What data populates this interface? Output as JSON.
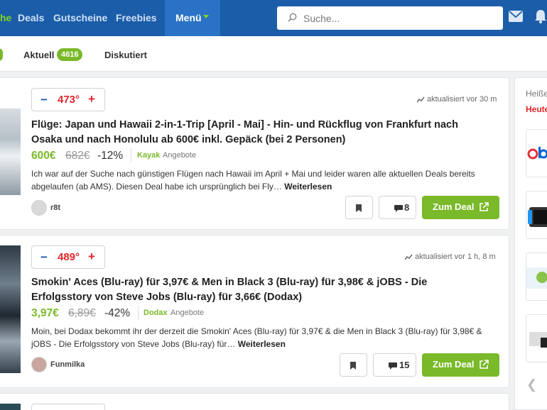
{
  "nav": {
    "partial_item": "he",
    "deals": "Deals",
    "gutscheine": "Gutscheine",
    "freebies": "Freebies",
    "menu": "Menü",
    "search_placeholder": "Suche..."
  },
  "tabs": {
    "aktuell": "Aktuell",
    "aktuell_count": "4616",
    "diskutiert": "Diskutiert"
  },
  "deals": [
    {
      "temperature": "473°",
      "updated": "aktualisiert vor 30 m",
      "title": "Flüge: Japan und Hawaii 2-in-1-Trip [April - Mai] - Hin- und Rückflug von Frankfurt nach Osaka und nach Honolulu ab 600€ inkl. Gepäck (bei 2 Personen)",
      "price": "600€",
      "old_price": "682€",
      "discount": "-12%",
      "merchant": "Kayak",
      "merchant_suffix": "Angebote",
      "description": "Ich war auf der Suche nach günstigen Flügen nach Hawaii im April + Mai und leider waren alle aktuellen Deals bereits abgelaufen (ab AMS). Diesen Deal habe ich ursprünglich bei Fly…",
      "read_more": "Weiterlesen",
      "user": "r8t",
      "comments": "8",
      "cta": "Zum Deal"
    },
    {
      "temperature": "489°",
      "updated": "aktualisiert vor 1 h, 8 m",
      "title": "Smokin' Aces (Blu-ray) für 3,97€ & Men in Black 3 (Blu-ray) für 3,98€ & jOBS - Die Erfolgsstory von Steve Jobs (Blu-ray) für 3,66€ (Dodax)",
      "price": "3,97€",
      "old_price": "6,89€",
      "discount": "-42%",
      "merchant": "Dodax",
      "merchant_suffix": "Angebote",
      "description": "Moin, bei Dodax bekommt ihr der derzeit die Smokin' Aces (Blu-ray) für 3,97€ & die Men in Black 3 (Blu-ray) für 3,98€ & jOBS - Die Erfolgsstory von Steve Jobs (Blu-ray) für…",
      "read_more": "Weiterlesen",
      "user": "Funmilka",
      "comments": "15",
      "cta": "Zum Deal"
    }
  ],
  "sidebar": {
    "title": "Heiße",
    "subtitle": "Heute"
  },
  "colors": {
    "nav_bg": "#1b5da8",
    "accent_green": "#7ab929",
    "hot_red": "#e0262b"
  }
}
